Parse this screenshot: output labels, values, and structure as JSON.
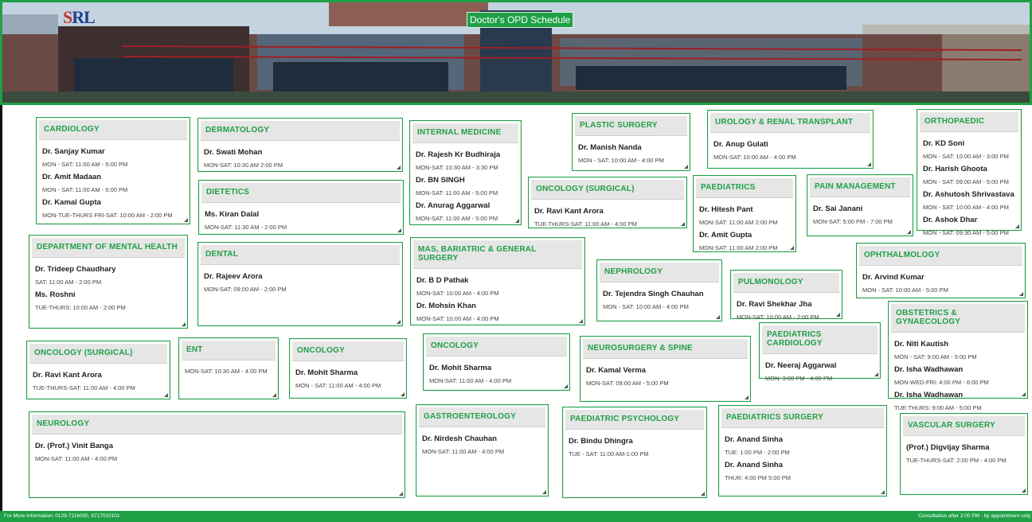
{
  "header": {
    "title": "Doctor's OPD Schedule",
    "logo_text": "SRL"
  },
  "footer": {
    "left": "For More Information: 0129-7116000, 9717010101",
    "right": "Consultation after 2:00 PM - by appointment only"
  },
  "cards": [
    {
      "name": "CARDIOLOGY",
      "doctors": [
        {
          "name": "Dr. Sanjay Kumar",
          "time": "MON - SAT: 11:00 AM - 5:00 PM"
        },
        {
          "name": "Dr. Amit Madaan",
          "time": "MON - SAT: 11:00 AM - 5:00 PM"
        },
        {
          "name": "Dr. Kamal Gupta",
          "time": "MON-TUE-THURS FRI-SAT: 10:00 AM - 2:00 PM"
        }
      ]
    },
    {
      "name": "DERMATOLOGY",
      "doctors": [
        {
          "name": "Dr. Swati Mohan",
          "time": "MON-SAT: 10:30 AM 2:00 PM"
        }
      ]
    },
    {
      "name": "DIETETICS",
      "doctors": [
        {
          "name": "Ms. Kiran Dalal",
          "time": "MON-SAT: 11:30 AM - 2:00 PM"
        }
      ]
    },
    {
      "name": "INTERNAL MEDICINE",
      "doctors": [
        {
          "name": "Dr. Rajesh Kr Budhiraja",
          "time": "MON-SAT: 10:30 AM - 3:30 PM"
        },
        {
          "name": "Dr. BN SINGH",
          "time": "MON-SAT: 11:00 AM - 5:00 PM"
        },
        {
          "name": "Dr. Anurag Aggarwal",
          "time": "MON-SAT: 11:00 AM - 5:00 PM"
        }
      ]
    },
    {
      "name": "PLASTIC SURGERY",
      "doctors": [
        {
          "name": "Dr. Manish Nanda",
          "time": "MON - SAT: 10:00 AM - 4:00 PM"
        }
      ]
    },
    {
      "name": "UROLOGY & RENAL TRANSPLANT",
      "doctors": [
        {
          "name": "Dr. Anup Gulati",
          "time": "MON-SAT: 10:00 AM - 4:00 PM"
        }
      ]
    },
    {
      "name": "ORTHOPAEDIC",
      "doctors": [
        {
          "name": "Dr. KD Soni",
          "time": "MON - SAT: 10:00 AM - 3:00 PM"
        },
        {
          "name": "Dr. Harish Ghoota",
          "time": "MON - SAT: 09:00 AM - 5:00 PM"
        },
        {
          "name": "Dr. Ashutosh Shrivastava",
          "time": "MON - SAT: 10:00 AM - 4:00 PM"
        },
        {
          "name": "Dr. Ashok Dhar",
          "time": "MON - SAT: 09:30 AM - 5:00 PM"
        }
      ]
    },
    {
      "name": "ONCOLOGY (SURGICAL)",
      "doctors": [
        {
          "name": "Dr. Ravi Kant Arora",
          "time": "TUE-THURS-SAT: 11:00 AM - 4:00 PM"
        }
      ]
    },
    {
      "name": "PAEDIATRICS",
      "doctors": [
        {
          "name": "Dr. Hitesh Pant",
          "time": "MON-SAT: 11:00 AM 2:00 PM"
        },
        {
          "name": "Dr. Amit Gupta",
          "time": "MON-SAT: 11:00 AM 2:00 PM"
        }
      ]
    },
    {
      "name": "PAIN MANAGEMENT",
      "doctors": [
        {
          "name": "Dr. Sai Janani",
          "time": "MON-SAT: 5:00 PM - 7:00 PM"
        }
      ]
    },
    {
      "name": "DEPARTMENT OF MENTAL HEALTH",
      "doctors": [
        {
          "name": "Dr. Trideep Chaudhary",
          "time": "SAT: 11:00 AM - 2:00 PM"
        },
        {
          "name": "Ms. Roshni",
          "time": "TUE-THURS: 10:00 AM - 2:00 PM"
        }
      ]
    },
    {
      "name": "DENTAL",
      "doctors": [
        {
          "name": "Dr. Rajeev Arora",
          "time": "MON-SAT: 09:00 AM - 2:00 PM"
        }
      ]
    },
    {
      "name": "MAS, BARIATRIC & GENERAL SURGERY",
      "doctors": [
        {
          "name": "Dr. B D Pathak",
          "time": "MON-SAT: 10:00 AM - 4:00 PM"
        },
        {
          "name": "Dr. Mohsin Khan",
          "time": "MON-SAT: 10:00 AM - 4:00 PM"
        }
      ]
    },
    {
      "name": "NEPHROLOGY",
      "doctors": [
        {
          "name": "Dr. Tejendra Singh Chauhan",
          "time": "MON - SAT: 10:00 AM - 4:00 PM"
        }
      ]
    },
    {
      "name": "PULMONOLOGY",
      "doctors": [
        {
          "name": "Dr. Ravi Shekhar Jha",
          "time": "MON-SAT: 10:00 AM - 2:00 PM"
        }
      ]
    },
    {
      "name": "OPHTHALMOLOGY",
      "doctors": [
        {
          "name": "Dr. Arvind Kumar",
          "time": "MON - SAT: 10:00 AM - 5:00 PM"
        }
      ]
    },
    {
      "name": "ONCOLOGY (SURGICAL)",
      "doctors": [
        {
          "name": "Dr. Ravi Kant Arora",
          "time": "TUE-THURS-SAT: 11:00 AM - 4:00 PM"
        }
      ]
    },
    {
      "name": "ENT",
      "doctors": [
        {
          "name": "",
          "time": "MON-SAT: 10:30 AM - 4:00 PM"
        }
      ]
    },
    {
      "name": "ONCOLOGY",
      "doctors": [
        {
          "name": "Dr. Mohit Sharma",
          "time": "MON - SAT: 11:00 AM - 4:00 PM"
        }
      ]
    },
    {
      "name": "ONCOLOGY",
      "doctors": [
        {
          "name": "Dr. Mohit Sharma",
          "time": "MON-SAT: 11:00 AM - 4:00 PM"
        }
      ]
    },
    {
      "name": "NEUROSURGERY & SPINE",
      "doctors": [
        {
          "name": "Dr. Kamal Verma",
          "time": "MON-SAT: 09:00 AM - 5:00 PM"
        }
      ]
    },
    {
      "name": "PAEDIATRICS CARDIOLOGY",
      "doctors": [
        {
          "name": "Dr. Neeraj Aggarwal",
          "time": "MON: 3:00 PM - 4:00 PM"
        }
      ]
    },
    {
      "name": "OBSTETRICS & GYNAECOLOGY",
      "doctors": [
        {
          "name": "Dr. Niti Kautish",
          "time": "MON - SAT: 9:00 AM - 5:00 PM"
        },
        {
          "name": "Dr. Isha Wadhawan",
          "time": "MON-WED-FRI: 4:00 PM - 6:00 PM"
        },
        {
          "name": "Dr. Isha Wadhawan",
          "time": "TUE-THURS: 9:00 AM - 5:00 PM"
        }
      ]
    },
    {
      "name": "NEUROLOGY",
      "doctors": [
        {
          "name": "Dr. (Prof.) Vinit Banga",
          "time": "MON-SAT: 11:00 AM - 4:00 PM"
        }
      ]
    },
    {
      "name": "GASTROENTEROLOGY",
      "doctors": [
        {
          "name": "Dr. Nirdesh Chauhan",
          "time": "MON-SAT: 11:00 AM - 4:00 PM"
        }
      ]
    },
    {
      "name": "PAEDIATRIC PSYCHOLOGY",
      "doctors": [
        {
          "name": "Dr. Bindu Dhingra",
          "time": "TUE - SAT: 11:00 AM-1:00 PM"
        }
      ]
    },
    {
      "name": "PAEDIATRICS SURGERY",
      "doctors": [
        {
          "name": "Dr. Anand Sinha",
          "time": "TUE: 1:00 PM - 2:00 PM"
        },
        {
          "name": "Dr. Anand Sinha",
          "time": "THUR: 4:00 PM 5:00 PM"
        }
      ]
    },
    {
      "name": "VASCULAR SURGERY",
      "doctors": [
        {
          "name": "(Prof.) Digvijay Sharma",
          "time": "TUE-THURS-SAT: 2:00 PM - 4:00 PM"
        }
      ]
    }
  ]
}
